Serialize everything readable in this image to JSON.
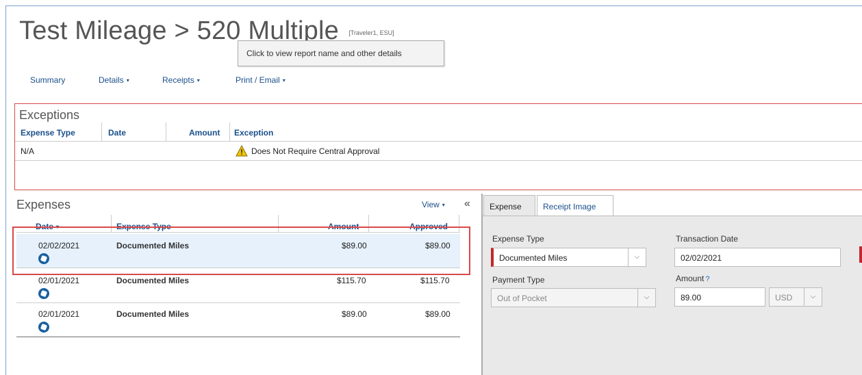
{
  "report": {
    "title": "Test Mileage > 520 Multiple",
    "subtitle": "[Traveler1, ESU]",
    "tooltip": "Click to view report name and other details"
  },
  "menu": {
    "summary": "Summary",
    "details": "Details",
    "receipts": "Receipts",
    "print_email": "Print / Email",
    "caret": "▾"
  },
  "exceptions": {
    "title": "Exceptions",
    "columns": [
      "Expense Type",
      "Date",
      "Amount",
      "Exception"
    ],
    "rows": [
      {
        "expense_type": "N/A",
        "date": "",
        "amount": "",
        "exception": "Does Not Require Central Approval"
      }
    ]
  },
  "expenses": {
    "title": "Expenses",
    "view_label": "View",
    "collapse": "«",
    "columns": [
      "Date",
      "Expense Type",
      "Amount",
      "Approved"
    ],
    "sort_indicator": "▾",
    "rows": [
      {
        "date": "02/02/2021",
        "type": "Documented Miles",
        "amount": "$89.00",
        "approved": "$89.00"
      },
      {
        "date": "02/01/2021",
        "type": "Documented Miles",
        "amount": "$115.70",
        "approved": "$115.70"
      },
      {
        "date": "02/01/2021",
        "type": "Documented Miles",
        "amount": "$89.00",
        "approved": "$89.00"
      }
    ]
  },
  "detail": {
    "tabs": [
      "Expense",
      "Receipt Image"
    ],
    "expense_type_label": "Expense Type",
    "expense_type_value": "Documented Miles",
    "transaction_date_label": "Transaction Date",
    "transaction_date_value": "02/02/2021",
    "payment_type_label": "Payment Type",
    "payment_type_value": "Out of Pocket",
    "amount_label": "Amount",
    "amount_help": "?",
    "amount_value": "89.00",
    "currency": "USD",
    "dropdown": "⌵"
  },
  "colors": {
    "link": "#1a4f8b",
    "highlight": "#d94848",
    "selected_row": "#e6f1fb",
    "required": "#c0292b"
  }
}
